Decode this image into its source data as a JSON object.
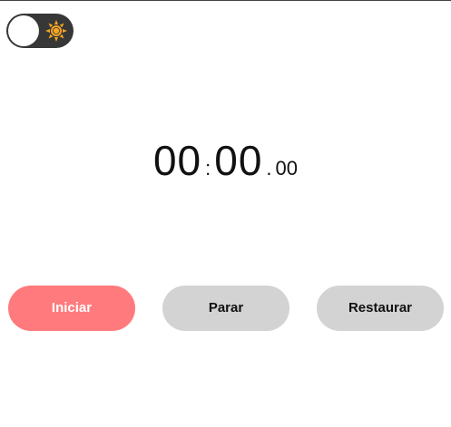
{
  "theme_toggle": {
    "icon": "sun-icon",
    "state": "light",
    "track_color": "#373737",
    "icon_color": "#f5a623"
  },
  "timer": {
    "minutes": "00",
    "separator_1": ":",
    "seconds": "00",
    "separator_2": ".",
    "centiseconds": "00"
  },
  "controls": {
    "start_label": "Iniciar",
    "stop_label": "Parar",
    "reset_label": "Restaurar",
    "start_color": "#ff7a7c",
    "secondary_color": "#d3d3d3"
  }
}
